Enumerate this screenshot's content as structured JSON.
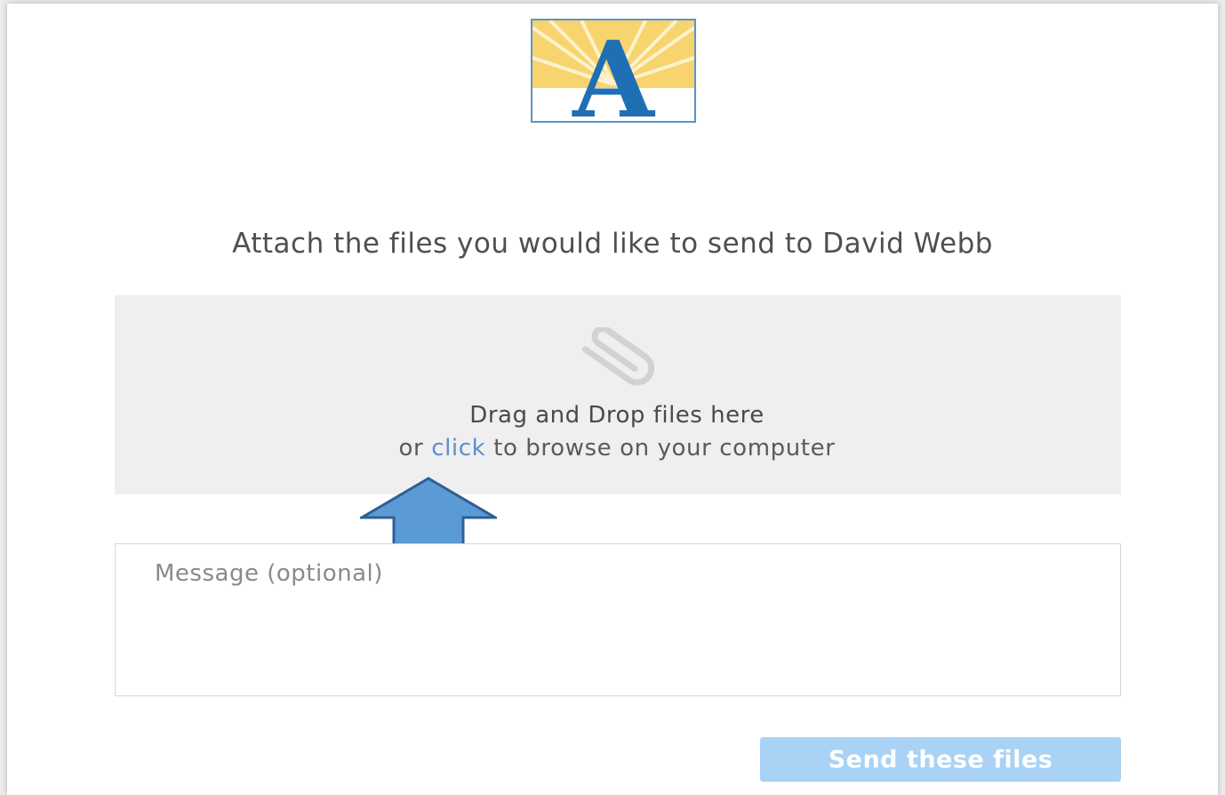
{
  "logo": {
    "letter": "A",
    "icon": "sunburst-a-logo",
    "colors": {
      "letter": "#1f6fb5",
      "rays": "#f4cc5a",
      "border": "#5b94c8"
    }
  },
  "heading": "Attach the files you would like to send to David Webb",
  "dropzone": {
    "icon": "paperclip-icon",
    "title": "Drag and Drop files here",
    "sub_prefix": "or ",
    "link_label": "click",
    "sub_suffix": " to browse on your computer"
  },
  "annotation": {
    "icon": "up-arrow-icon",
    "color": "#5b9bd5"
  },
  "message": {
    "placeholder": "Message (optional)",
    "value": ""
  },
  "send_button": {
    "label": "Send these files",
    "color": "#a9d2f4"
  }
}
